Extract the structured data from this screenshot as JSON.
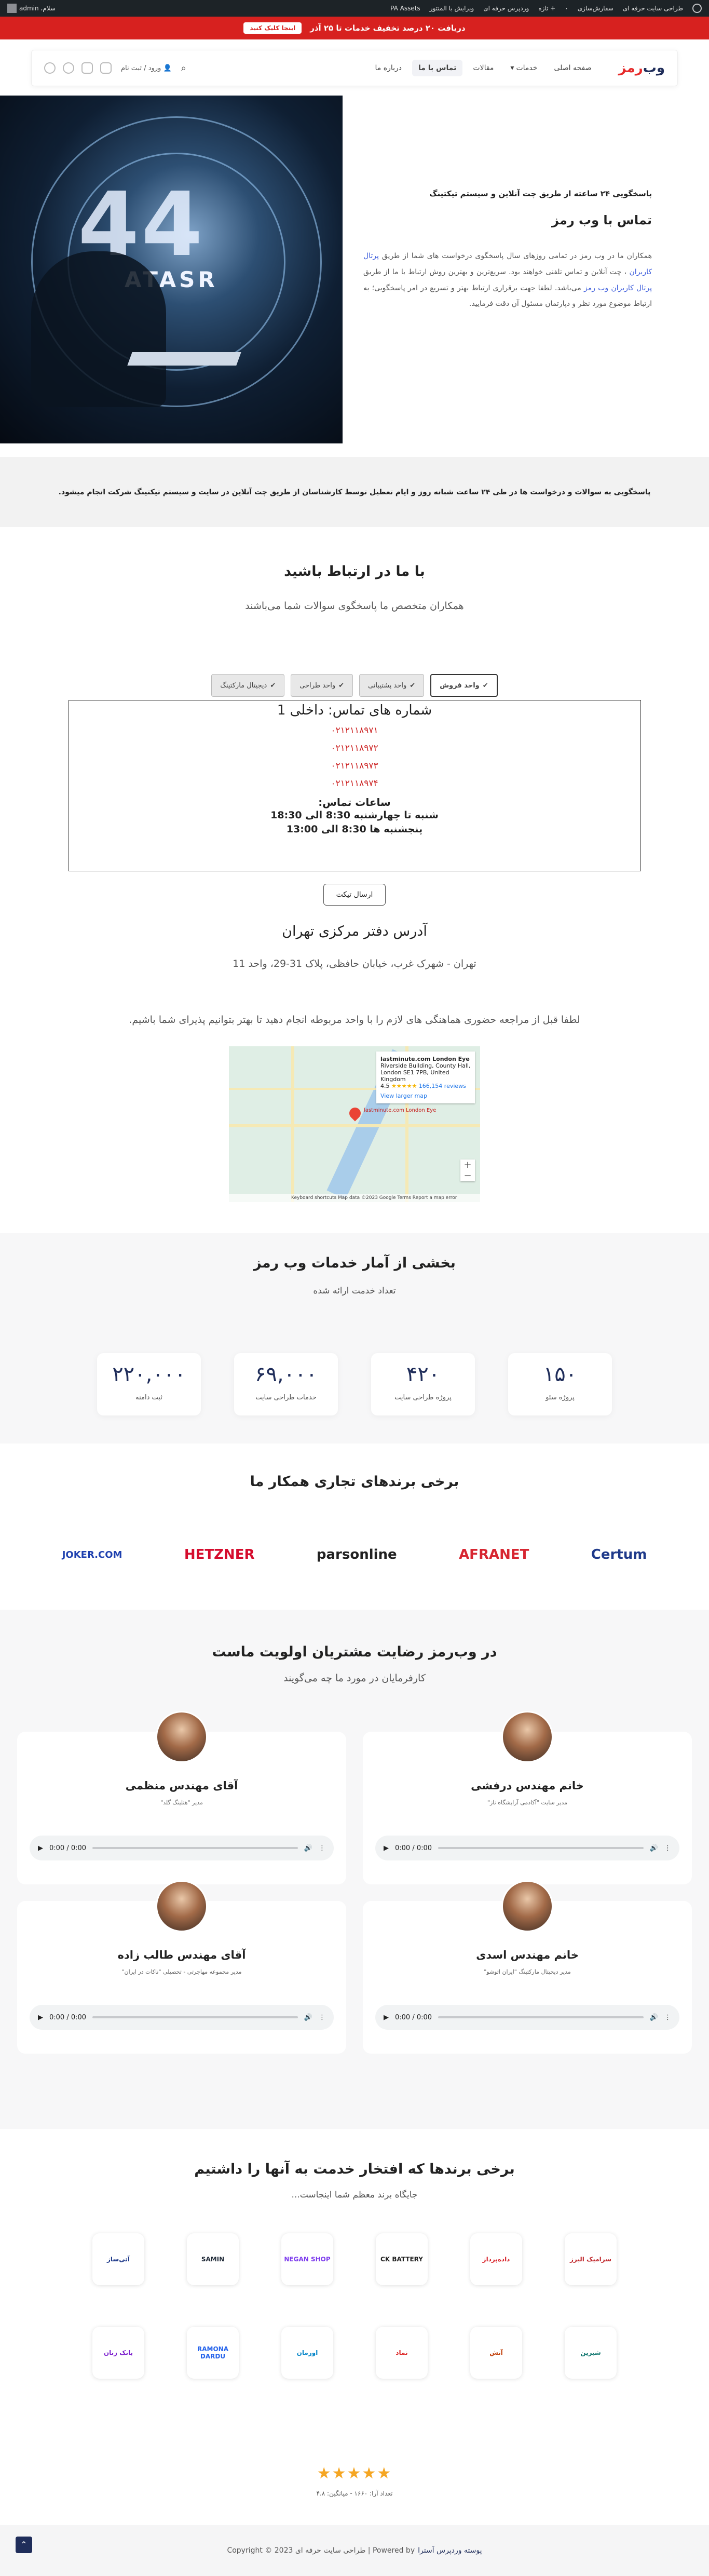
{
  "adminbar": {
    "greeting": "سلام، admin",
    "items": [
      "طراحی سایت حرفه ای",
      "سفارش‌سازی",
      "۰",
      "+ تازه",
      "وردپرس حرفه ای",
      "ویرایش با المنتور",
      "PA Assets"
    ]
  },
  "promo": {
    "text": "دریافت ۲۰ درصد تخفیف خدمات تا ۲۵ آذر",
    "button": "اینجا کلیک کنید"
  },
  "header": {
    "logo_main": "وب",
    "logo_accent": "رمز",
    "nav": [
      "صفحه اصلی",
      "خدمات",
      "مقالات",
      "تماس با ما",
      "درباره ما"
    ],
    "active_index": 3,
    "login": "ورود / ثبت نام"
  },
  "hero": {
    "image_text": "44",
    "image_brand": "ATASR",
    "kicker": "پاسخگویی ۲۴ ساعته از طریق چت آنلاین و سیستم تیکتینگ",
    "title": "تماس با وب رمز",
    "para_start": "همکاران ما در وب رمز در تمامی روزهای سال پاسخگوی درخواست های شما از طریق",
    "para_link1": "پرتال کاربران",
    "para_mid": "، چت آنلاین و تماس تلفنی خواهند بود. سریع‌ترین و بهترین روش ارتباط با ما از طریق",
    "para_link2": "پرتال کاربران وب رمز",
    "para_end": "می‌باشد. لطفا جهت برقراری ارتباط بهتر و تسریع در امر پاسخگویی؛ به ارتباط موضوع مورد نظر و دپارتمان مسئول آن دقت فرمایید."
  },
  "strip": {
    "text": "پاسخگویی به سوالات و درخواست ها در طی ۲۴ ساعت شبانه روز و ایام تعطیل توسط کارشناسان از طریق چت آنلاین در سایت و سیستم تیکتینگ شرکت انجام میشود."
  },
  "contact": {
    "title": "با ما در ارتباط باشید",
    "subtitle": "همکاران متخصص ما پاسخگوی سوالات شما می‌باشند",
    "tabs": [
      "واحد فروش",
      "واحد پشتیبانی",
      "واحد طراحی",
      "دیجیتال مارکتینگ"
    ],
    "phones_title": "شماره های تماس: داخلی 1",
    "phones": [
      "۰۲۱۲۱۱۸۹۷۱",
      "۰۲۱۲۱۱۸۹۷۲",
      "۰۲۱۲۱۱۸۹۷۳",
      "۰۲۱۲۱۱۸۹۷۴"
    ],
    "hours_title": "ساعات تماس:",
    "hours": [
      "شنبه تا چهارشنبه 8:30 الی 18:30",
      "پنجشنبه ها 8:30 الی 13:00"
    ],
    "ticket_button": "ارسال تیکت",
    "address_title": "آدرس دفتر مرکزی تهران",
    "address": "تهران - شهرک غرب، خیابان حافظی، پلاک 31-29، واحد 11",
    "notice": "لطفا قبل از مراجعه حضوری هماهنگی های لازم را با واحد مربوطه انجام دهید تا بهتر بتوانیم پذیرای شما باشیم."
  },
  "map": {
    "place": "lastminute.com London Eye",
    "address1": "Riverside Building, County Hall,",
    "address2": "London SE1 7PB, United Kingdom",
    "rating": "4.5",
    "stars": "★★★★★",
    "reviews": "166,154 reviews",
    "link": "View larger map",
    "pin_label": "lastminute.com London Eye",
    "zoom_in": "+",
    "zoom_out": "−",
    "footer": "Keyboard shortcuts   Map data ©2023 Google   Terms   Report a map error"
  },
  "stats": {
    "title": "بخشی از آمار خدمات وب رمز",
    "subtitle": "تعداد خدمت ارائه شده",
    "items": [
      {
        "value": "۱۵۰",
        "label": "پروژه سئو"
      },
      {
        "value": "۴۲۰",
        "label": "پروژه طراحی سایت"
      },
      {
        "value": "۶۹,۰۰۰",
        "label": "خدمات طراحی سایت"
      },
      {
        "value": "۲۲۰,۰۰۰",
        "label": "ثبت دامنه"
      }
    ]
  },
  "partners": {
    "title": "برخی برندهای تجاری همکار ما",
    "logos": [
      "Certum",
      "AFRANET",
      "parsonline",
      "HETZNER",
      "JOKER.COM"
    ]
  },
  "testimonials": {
    "title": "در وب‌رمز رضایت مشتریان اولویت ماست",
    "subtitle": "کارفرمایان در مورد ما چه می‌گویند",
    "items": [
      {
        "name": "خانم مهندس درفشی",
        "role": "مدیر سایت \"آکادمی آرایشگاه ناز\""
      },
      {
        "name": "آقای مهندس منظمی",
        "role": "مدیر \"هتلینگ گلد\""
      },
      {
        "name": "خانم مهندس اسدی",
        "role": "مدیر دیجیتال مارکتینگ \"ایران اتوشو\""
      },
      {
        "name": "آقای مهندس طالب زاده",
        "role": "مدیر مجموعه مهاجرتی - تحصیلی \"ناکات در ایران\""
      }
    ],
    "audio_time": "0:00 / 0:00"
  },
  "clients": {
    "title": "برخی برندها‌ که افتخار خدمت به آنها را داشتیم",
    "subtitle": "جایگاه برند معظم شما اینجاست...",
    "logos": [
      {
        "text": "سرامیک البرز",
        "color": "#c0282d"
      },
      {
        "text": "داده‌پرداز",
        "color": "#d8232a"
      },
      {
        "text": "CK BATTERY",
        "color": "#222222"
      },
      {
        "text": "NEGAN SHOP",
        "color": "#7c3aed"
      },
      {
        "text": "SAMIN",
        "color": "#1f2937"
      },
      {
        "text": "آتی‌ساز",
        "color": "#1f3a8a"
      },
      {
        "text": "شیرین",
        "color": "#0f766e"
      },
      {
        "text": "آتش",
        "color": "#c2410c"
      },
      {
        "text": "نماد",
        "color": "#dc2626"
      },
      {
        "text": "اورمان",
        "color": "#0284c7"
      },
      {
        "text": "RAMONA DARDU",
        "color": "#2563eb"
      },
      {
        "text": "بانک زنان",
        "color": "#7e22ce"
      }
    ]
  },
  "rating": {
    "stars": "★★★★★",
    "text": "تعداد آرا: ۱۶۶۰ - میانگین: ۴.۸"
  },
  "footer": {
    "text": "Copyright © 2023 طراحی سایت حرفه ای | Powered by",
    "link": "پوسته وردپرس آسترا",
    "back_top": "⌃"
  }
}
